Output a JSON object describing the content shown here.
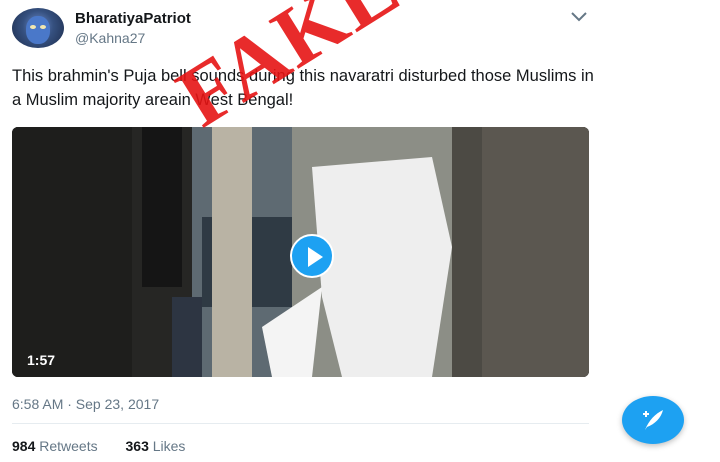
{
  "tweet": {
    "display_name": "BharatiyaPatriot",
    "handle": "@Kahna27",
    "text": "This brahmin's Puja bell sounds during this navaratri disturbed those Muslims in a Muslim majority areain West Bengal!",
    "stamp": "FAKE",
    "video_duration": "1:57",
    "timestamp": "6:58 AM · Sep 23, 2017",
    "retweets_count": "984",
    "retweets_label": "Retweets",
    "likes_count": "363",
    "likes_label": "Likes"
  },
  "colors": {
    "accent": "#1da1f2",
    "stamp": "#e61414",
    "secondary_text": "#657786"
  },
  "icons": {
    "menu": "chevron-down-icon",
    "play": "play-icon",
    "compose": "compose-tweet-icon"
  }
}
